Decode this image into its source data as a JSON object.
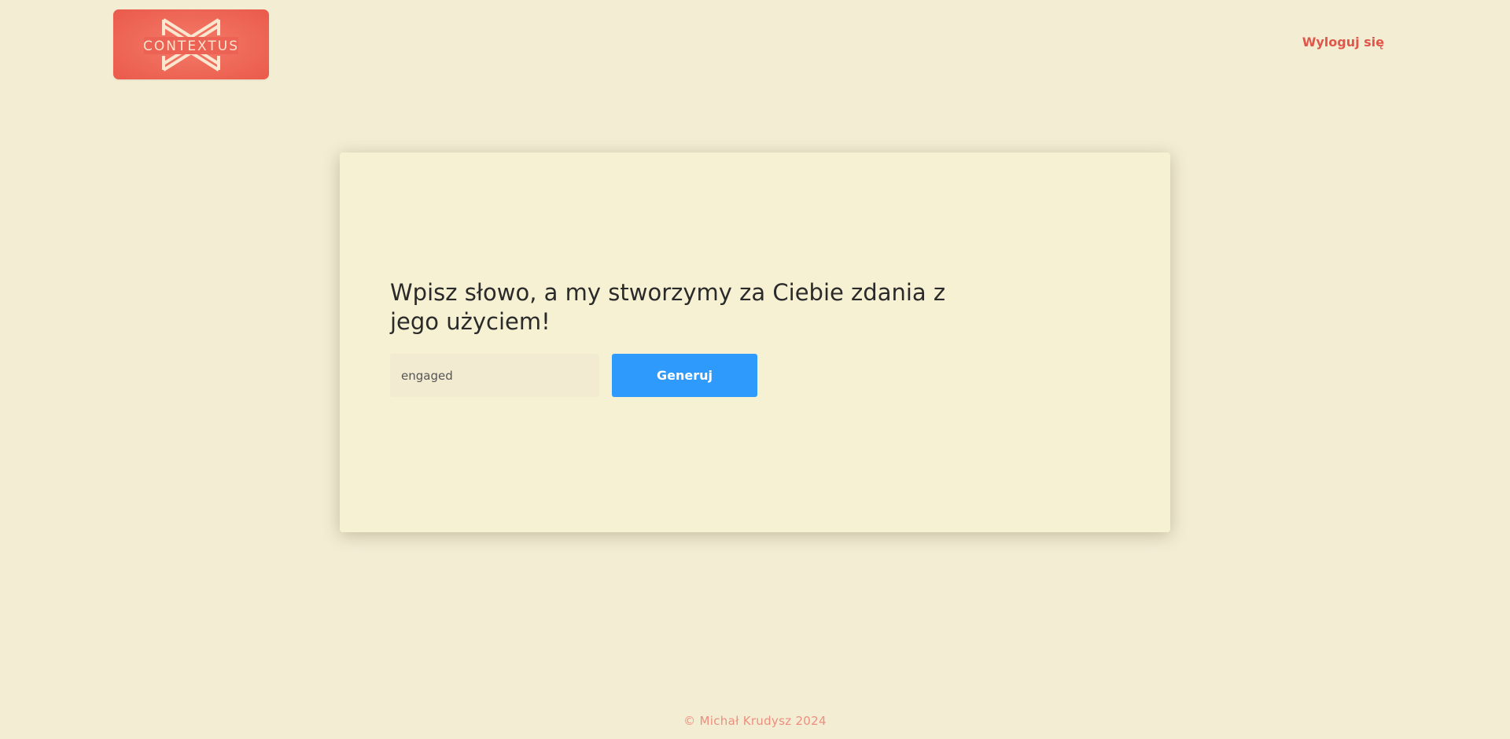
{
  "header": {
    "logo_text": "CONTEXTUS",
    "logout_label": "Wyloguj się"
  },
  "main": {
    "headline": "Wpisz słowo, a my stworzymy za Ciebie zdania z jego użyciem!",
    "input_value": "engaged",
    "generate_label": "Generuj"
  },
  "footer": {
    "copyright": "© Michał Krudysz 2024"
  },
  "colors": {
    "background": "#f3edd4",
    "card": "#f7f1d3",
    "brand": "#ea5a4b",
    "button": "#2e9bfc",
    "footer_text": "#ec8f7e"
  },
  "icons": {
    "logo": "contextus-logo-icon"
  }
}
